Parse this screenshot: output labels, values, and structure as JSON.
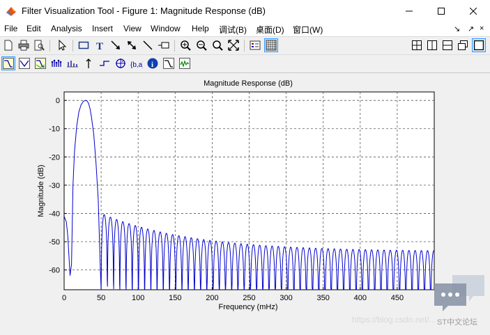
{
  "window": {
    "title": "Filter Visualization Tool - Figure 1: Magnitude Response (dB)"
  },
  "menu": {
    "items": [
      "File",
      "Edit",
      "Analysis",
      "Insert",
      "View",
      "Window",
      "Help",
      "调试(B)",
      "桌面(D)",
      "窗口(W)"
    ]
  },
  "toolbar": {
    "icons": [
      "new-file-icon",
      "print-icon",
      "print-preview-icon",
      "select-arrow-icon",
      "rectangle-icon",
      "text-icon",
      "arrow-icon",
      "arrow-double-icon",
      "line-icon",
      "callout-icon",
      "zoom-in-icon",
      "zoom-out-icon",
      "zoom-x-icon",
      "full-view-icon",
      "legend-icon",
      "grid-icon"
    ],
    "layout_icons": [
      "tile-icon",
      "split-vertical-icon",
      "split-horizontal-icon",
      "restore-icon",
      "maximize-panel-icon"
    ],
    "analysis_icons": [
      "magnitude-icon",
      "phase-icon",
      "magnitude-phase-icon",
      "group-delay-icon",
      "impulse-response-icon",
      "step-response-icon",
      "pole-zero-icon",
      "coefficients-icon",
      "info-icon",
      "filter-response-icon",
      "noise-icon"
    ]
  },
  "chart_data": {
    "type": "line",
    "title": "Magnitude Response (dB)",
    "xlabel": "Frequency (mHz)",
    "ylabel": "Magnitude (dB)",
    "xlim": [
      0,
      500
    ],
    "ylim": [
      -67,
      3
    ],
    "xticks": [
      0,
      50,
      100,
      150,
      200,
      250,
      300,
      350,
      400,
      450
    ],
    "yticks": [
      0,
      -10,
      -20,
      -30,
      -40,
      -50,
      -60
    ],
    "grid": true,
    "series": [
      {
        "color": "#0000cc",
        "x": [
          0,
          3,
          5,
          8,
          10,
          12,
          14,
          17,
          20,
          23,
          26,
          29,
          31,
          33,
          35,
          37,
          40,
          43,
          46,
          49,
          50,
          52,
          54,
          57,
          60,
          63,
          66,
          69,
          72,
          76,
          80,
          85,
          90,
          95,
          100,
          110,
          120,
          150,
          200,
          250,
          300,
          350,
          400,
          450,
          500
        ],
        "y": [
          -41,
          -43,
          -48,
          -62,
          -58,
          -30,
          -18,
          -9,
          -4,
          -1.5,
          -0.3,
          0,
          -0.2,
          -1,
          -3,
          -6,
          -12,
          -22,
          -35,
          -60,
          -67,
          -55,
          -57,
          -45,
          -42,
          -45,
          -52,
          -43,
          -41.5,
          -44,
          -50,
          -43,
          -42,
          -47,
          -44,
          -45,
          -46,
          -47,
          -49,
          -50.5,
          -51.5,
          -52,
          -52.5,
          -53,
          -53.5
        ]
      }
    ]
  },
  "watermark": {
    "text": "https://blog.csdn.net/...",
    "site": "ST中文论坛"
  }
}
